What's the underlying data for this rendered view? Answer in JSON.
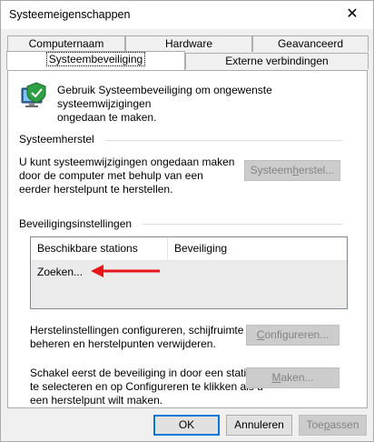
{
  "window": {
    "title": "Systeemeigenschappen",
    "close_glyph": "✕"
  },
  "tabs": {
    "row1": [
      "Computernaam",
      "Hardware",
      "Geavanceerd"
    ],
    "row2": [
      "Systeembeveiliging",
      "Externe verbindingen"
    ],
    "active": "Systeembeveiliging"
  },
  "intro": {
    "icon": "system-protection-icon",
    "line1": "Gebruik Systeembeveiliging om ongewenste systeemwijzigingen",
    "line2": "ongedaan te maken."
  },
  "restore": {
    "title": "Systeemherstel",
    "line1": "U kunt systeemwijzigingen ongedaan maken",
    "line2": "door de computer met behulp van een",
    "line3": "eerder herstelpunt te herstellen.",
    "button_pre": "Systeem",
    "button_u": "h",
    "button_post": "erstel..."
  },
  "protection": {
    "title": "Beveiligingsinstellingen",
    "columns": [
      "Beschikbare stations",
      "Beveiliging"
    ],
    "row": "Zoeken...",
    "arrow_color": "#e8141b"
  },
  "configure": {
    "line1": "Herstelinstellingen configureren, schijfruimte",
    "line2": "beheren en herstelpunten verwijderen.",
    "button_u": "C",
    "button_post": "onfigureren..."
  },
  "create": {
    "line1": "Schakel eerst de beveiliging in door een station",
    "line2": "te selecteren en op Configureren te klikken als u",
    "line3": "een herstelpunt wilt maken.",
    "button_u": "M",
    "button_post": "aken..."
  },
  "footer": {
    "ok": "OK",
    "cancel": "Annuleren",
    "apply_pre": "Toe",
    "apply_u": "p",
    "apply_post": "assen"
  }
}
